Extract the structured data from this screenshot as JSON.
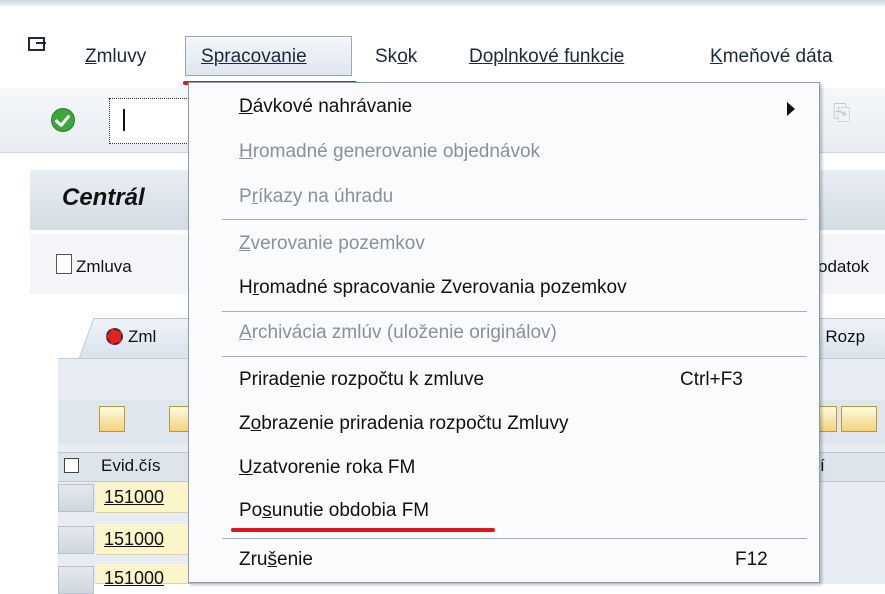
{
  "menubar": {
    "items": [
      {
        "pre": "",
        "u": "Z",
        "post": "mluvy"
      },
      {
        "pre": "",
        "u": "S",
        "post": "pracovanie"
      },
      {
        "pre": "Sk",
        "u": "o",
        "post": "k"
      },
      {
        "pre": "",
        "u": "D",
        "post": "oplnkové funkcie"
      },
      {
        "pre": "",
        "u": "K",
        "post": "meňové dáta"
      }
    ]
  },
  "title": "Centrál",
  "appbar": {
    "zmluva": "Zmluva",
    "dodatok": "odatok"
  },
  "tabs": {
    "tab1": "Zml",
    "tab2": " - Rozp"
  },
  "grid": {
    "header": {
      "evid": "Evid.čís",
      "right": "í"
    },
    "rows": [
      "151000",
      "151000",
      "151000"
    ]
  },
  "dropdown": {
    "items": [
      {
        "pre": "",
        "u": "D",
        "post": "ávkové nahrávanie",
        "enabled": true,
        "submenu": true
      },
      {
        "pre": "",
        "u": "H",
        "post": "romadné generovanie objednávok",
        "enabled": false
      },
      {
        "pre": "P",
        "u": "r",
        "post": "íkazy na úhradu",
        "enabled": false
      },
      {
        "pre": "",
        "u": "Z",
        "post": "verovanie pozemkov",
        "enabled": false
      },
      {
        "pre": "H",
        "u": "r",
        "post": "omadné spracovanie Zverovania pozemkov",
        "enabled": true
      },
      {
        "pre": "",
        "u": "A",
        "post": "rchivácia zmlúv (uloženie originálov)",
        "enabled": false
      },
      {
        "pre": "Prirad",
        "u": "e",
        "post": "nie rozpočtu k zmluve",
        "enabled": true,
        "shortcut": "Ctrl+F3"
      },
      {
        "pre": "Z",
        "u": "o",
        "post": "brazenie priradenia rozpočtu Zmluvy",
        "enabled": true
      },
      {
        "pre": "",
        "u": "U",
        "post": "zatvorenie roka FM",
        "enabled": true
      },
      {
        "pre": "Po",
        "u": "s",
        "post": "unutie obdobia FM",
        "enabled": true
      },
      {
        "pre": "Zru",
        "u": "š",
        "post": "enie",
        "enabled": true,
        "shortcut": "F12"
      }
    ]
  },
  "colors": {
    "accent_red": "#e0161f",
    "ok_green": "#3da63a",
    "disabled_text": "#8a9096"
  }
}
